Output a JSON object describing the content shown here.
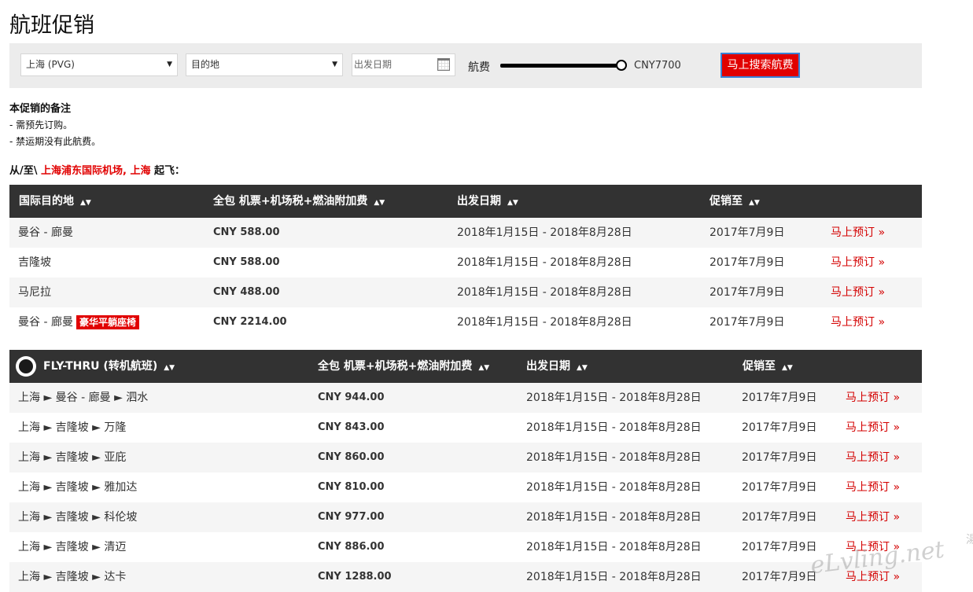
{
  "page_title": "航班促销",
  "search": {
    "origin": "上海 (PVG)",
    "destination": "目的地",
    "date_placeholder": "出发日期",
    "fare_label": "航费",
    "fare_value": "CNY7700",
    "fare_slider_fraction": 1.0,
    "button_label": "马上搜索航费"
  },
  "notes": {
    "title": "本促销的备注",
    "items": [
      "- 需预先订购。",
      "- 禁运期没有此航费。"
    ]
  },
  "from_line": {
    "prefix": "从/至\\",
    "airport": "上海浦东国际机场, 上海",
    "suffix": "起飞："
  },
  "intl_table": {
    "headers": [
      "国际目的地",
      "全包 机票+机场税+燃油附加费",
      "出发日期",
      "促销至"
    ],
    "rows": [
      {
        "dest": "曼谷 - 廊曼",
        "badge": "",
        "price": "CNY 588.00",
        "dates": "2018年1月15日 - 2018年8月28日",
        "until": "2017年7月9日",
        "book": "马上预订 »"
      },
      {
        "dest": "吉隆坡",
        "badge": "",
        "price": "CNY 588.00",
        "dates": "2018年1月15日 - 2018年8月28日",
        "until": "2017年7月9日",
        "book": "马上预订 »"
      },
      {
        "dest": "马尼拉",
        "badge": "",
        "price": "CNY 488.00",
        "dates": "2018年1月15日 - 2018年8月28日",
        "until": "2017年7月9日",
        "book": "马上预订 »"
      },
      {
        "dest": "曼谷 - 廊曼",
        "badge": "豪华平躺座椅",
        "price": "CNY 2214.00",
        "dates": "2018年1月15日 - 2018年8月28日",
        "until": "2017年7月9日",
        "book": "马上预订 »"
      }
    ]
  },
  "flythru_table": {
    "headers": [
      "FLY-THRU (转机航班)",
      "全包 机票+机场税+燃油附加费",
      "出发日期",
      "促销至"
    ],
    "rows": [
      {
        "route": "上海 ► 曼谷 - 廊曼 ► 泗水",
        "price": "CNY 944.00",
        "dates": "2018年1月15日 - 2018年8月28日",
        "until": "2017年7月9日",
        "book": "马上预订 »"
      },
      {
        "route": "上海 ► 吉隆坡 ► 万隆",
        "price": "CNY 843.00",
        "dates": "2018年1月15日 - 2018年8月28日",
        "until": "2017年7月9日",
        "book": "马上预订 »"
      },
      {
        "route": "上海 ► 吉隆坡 ► 亚庇",
        "price": "CNY 860.00",
        "dates": "2018年1月15日 - 2018年8月28日",
        "until": "2017年7月9日",
        "book": "马上预订 »"
      },
      {
        "route": "上海 ► 吉隆坡 ► 雅加达",
        "price": "CNY 810.00",
        "dates": "2018年1月15日 - 2018年8月28日",
        "until": "2017年7月9日",
        "book": "马上预订 »"
      },
      {
        "route": "上海 ► 吉隆坡 ► 科伦坡",
        "price": "CNY 977.00",
        "dates": "2018年1月15日 - 2018年8月28日",
        "until": "2017年7月9日",
        "book": "马上预订 »"
      },
      {
        "route": "上海 ► 吉隆坡 ► 清迈",
        "price": "CNY 886.00",
        "dates": "2018年1月15日 - 2018年8月28日",
        "until": "2017年7月9日",
        "book": "马上预订 »"
      },
      {
        "route": "上海 ► 吉隆坡 ► 达卡",
        "price": "CNY 1288.00",
        "dates": "2018年1月15日 - 2018年8月28日",
        "until": "2017年7月9日",
        "book": "马上预订 »"
      }
    ]
  },
  "watermark": "eLvling.net",
  "side_glyph": "湯"
}
